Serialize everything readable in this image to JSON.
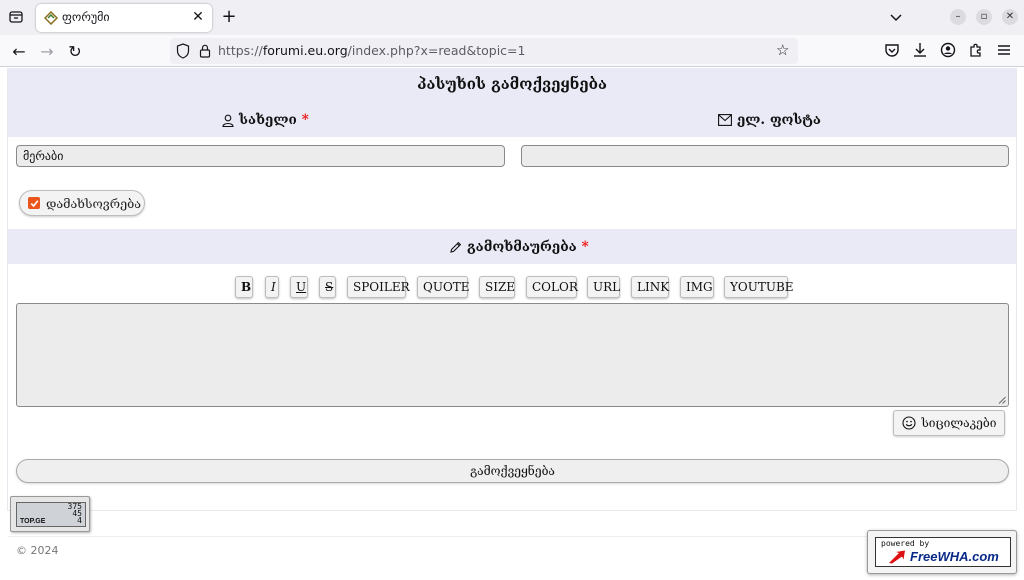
{
  "browser": {
    "tab_title": "ფორუმი",
    "url_prefix": "https://",
    "url_host": "forumi.eu.org",
    "url_path": "/index.php?x=read&topic=1"
  },
  "form": {
    "title": "პასუხის გამოქვეყნება",
    "name_label": "სახელი",
    "email_label": "ელ. ფოსტა",
    "required_mark": "*",
    "name_value": "მერაბი",
    "email_value": "",
    "remember_label": "დამახსოვრება",
    "remember_checked": true,
    "comment_label": "გამოხმაურება",
    "bbcode_buttons": [
      "B",
      "I",
      "U",
      "S",
      "SPOILER",
      "QUOTE",
      "SIZE",
      "COLOR",
      "URL",
      "LINK",
      "IMG",
      "YOUTUBE"
    ],
    "message_value": "",
    "smileys_label": "სიცილაკები",
    "submit_label": "გამოქვეყნება"
  },
  "counter": {
    "values": [
      "375",
      "45",
      "4"
    ],
    "brand": "TOP.GE"
  },
  "footer": {
    "copyright": "© 2024",
    "powered_by": "powered by",
    "powered_brand": "FreeWHA.com"
  },
  "colors": {
    "header_band": "#eaeaf7",
    "required": "#ee1111",
    "checkbox": "#e9551c"
  }
}
